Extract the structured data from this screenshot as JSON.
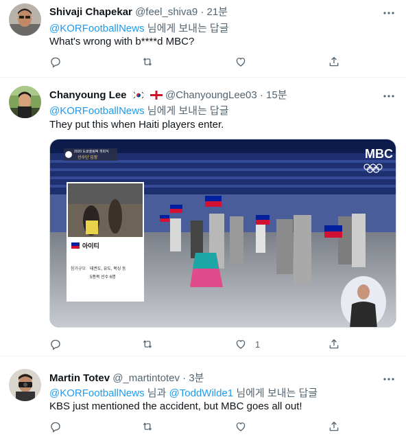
{
  "tweets": [
    {
      "name": "Shivaji Chapekar",
      "handle": "@feel_shiva9",
      "dot": "·",
      "time": "21분",
      "reply_mention": "@KORFootballNews",
      "reply_suffix": " 님에게 보내는 답글",
      "text": "What's wrong with b****d MBC?",
      "like_count": ""
    },
    {
      "name": "Chanyoung Lee",
      "handle": "@ChanyoungLee03",
      "dot": "·",
      "time": "15분",
      "reply_mention": "@KORFootballNews",
      "reply_suffix": " 님에게 보내는 답글",
      "text": "They put this when Haiti players enter.",
      "like_count": "1",
      "media": {
        "broadcaster_logo": "MBC",
        "caption_top": "2020 도쿄올림픽 개회식",
        "caption_sub": "선수단 입장",
        "country": "아이티",
        "detail_label": "참가규모",
        "detail_line1": "태권도, 유도, 복싱 등",
        "detail_line2": "5종목 선수 6명"
      }
    },
    {
      "name": "Martin Totev",
      "handle": "@_martintotev",
      "dot": "·",
      "time": "3분",
      "reply_mention": "@KORFootballNews",
      "reply_mid": " 님과 ",
      "reply_mention2": "@ToddWilde1",
      "reply_suffix": " 님에게 보내는 답글",
      "text": "KBS just mentioned the accident, but MBC goes all out!",
      "like_count": ""
    }
  ],
  "icons": [
    "reply-icon",
    "retweet-icon",
    "like-icon",
    "share-icon",
    "more-icon"
  ],
  "colors": {
    "mention": "#1d9bf0",
    "secondary": "#536471",
    "text": "#0f1419"
  }
}
